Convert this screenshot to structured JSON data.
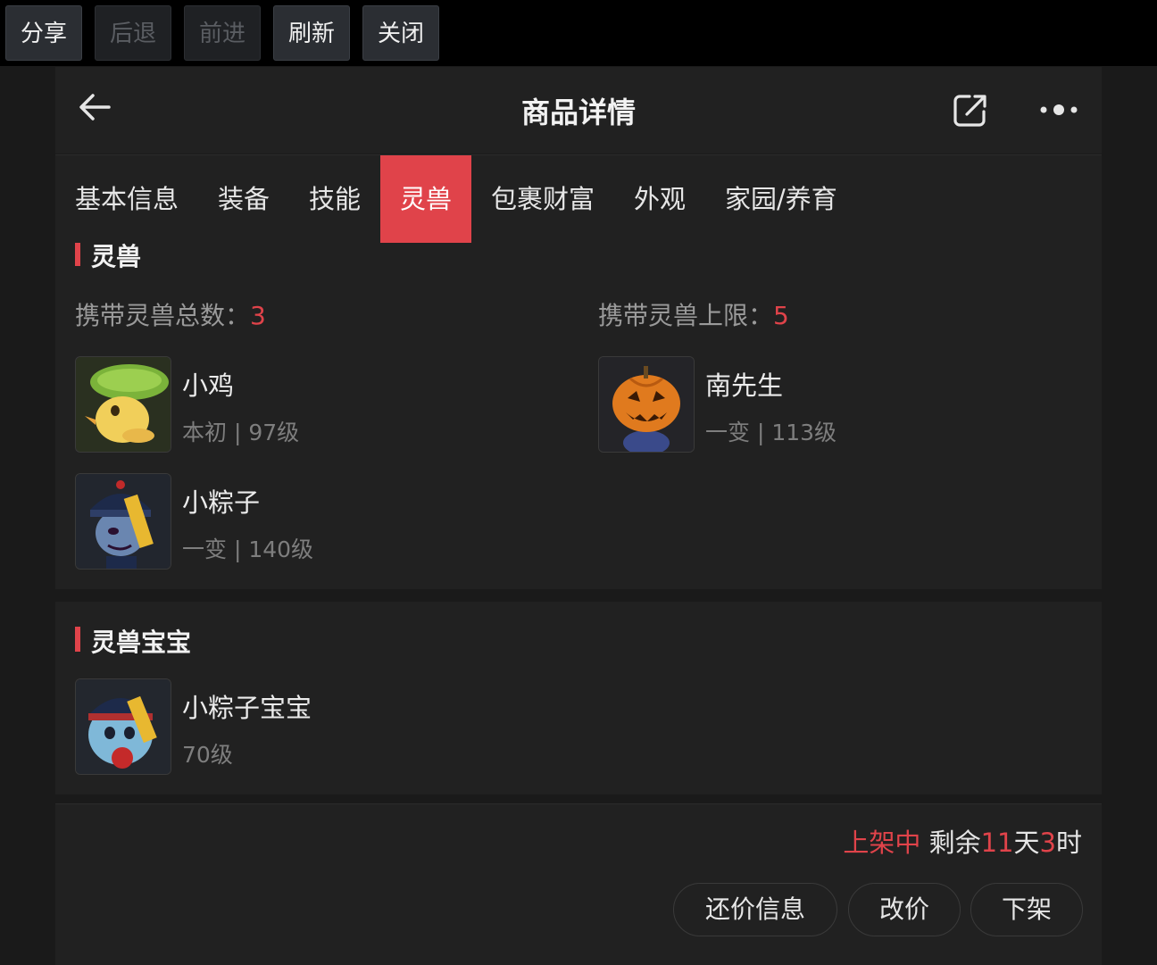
{
  "browser_bar": {
    "buttons": [
      {
        "label": "分享",
        "enabled": true
      },
      {
        "label": "后退",
        "enabled": false
      },
      {
        "label": "前进",
        "enabled": false
      },
      {
        "label": "刷新",
        "enabled": true
      },
      {
        "label": "关闭",
        "enabled": true
      }
    ]
  },
  "header": {
    "title": "商品详情",
    "icons": [
      "back-arrow-icon",
      "share-icon",
      "more-icon"
    ]
  },
  "tabs": {
    "items": [
      "基本信息",
      "装备",
      "技能",
      "灵兽",
      "包裹财富",
      "外观",
      "家园/养育"
    ],
    "active": "灵兽"
  },
  "pets_section": {
    "title": "灵兽",
    "total_label": "携带灵兽总数：",
    "total_value": "3",
    "limit_label": "携带灵兽上限：",
    "limit_value": "5",
    "pets": [
      {
        "name": "小鸡",
        "detail": "本初 | 97级",
        "icon": "chick-icon"
      },
      {
        "name": "南先生",
        "detail": "一变 | 113级",
        "icon": "pumpkin-icon"
      },
      {
        "name": "小粽子",
        "detail": "一变 | 140级",
        "icon": "zombie-icon"
      }
    ]
  },
  "baby_section": {
    "title": "灵兽宝宝",
    "pets": [
      {
        "name": "小粽子宝宝",
        "detail": "70级",
        "icon": "baby-zombie-icon"
      }
    ]
  },
  "footer": {
    "status_prefix": "上架中",
    "remaining_label": "剩余",
    "days_value": "11",
    "days_unit": "天",
    "hours_value": "3",
    "hours_unit": "时",
    "buttons": [
      "还价信息",
      "改价",
      "下架"
    ]
  },
  "colors": {
    "accent": "#e0434a",
    "background": "#1a1a1a",
    "panel": "#212121"
  }
}
